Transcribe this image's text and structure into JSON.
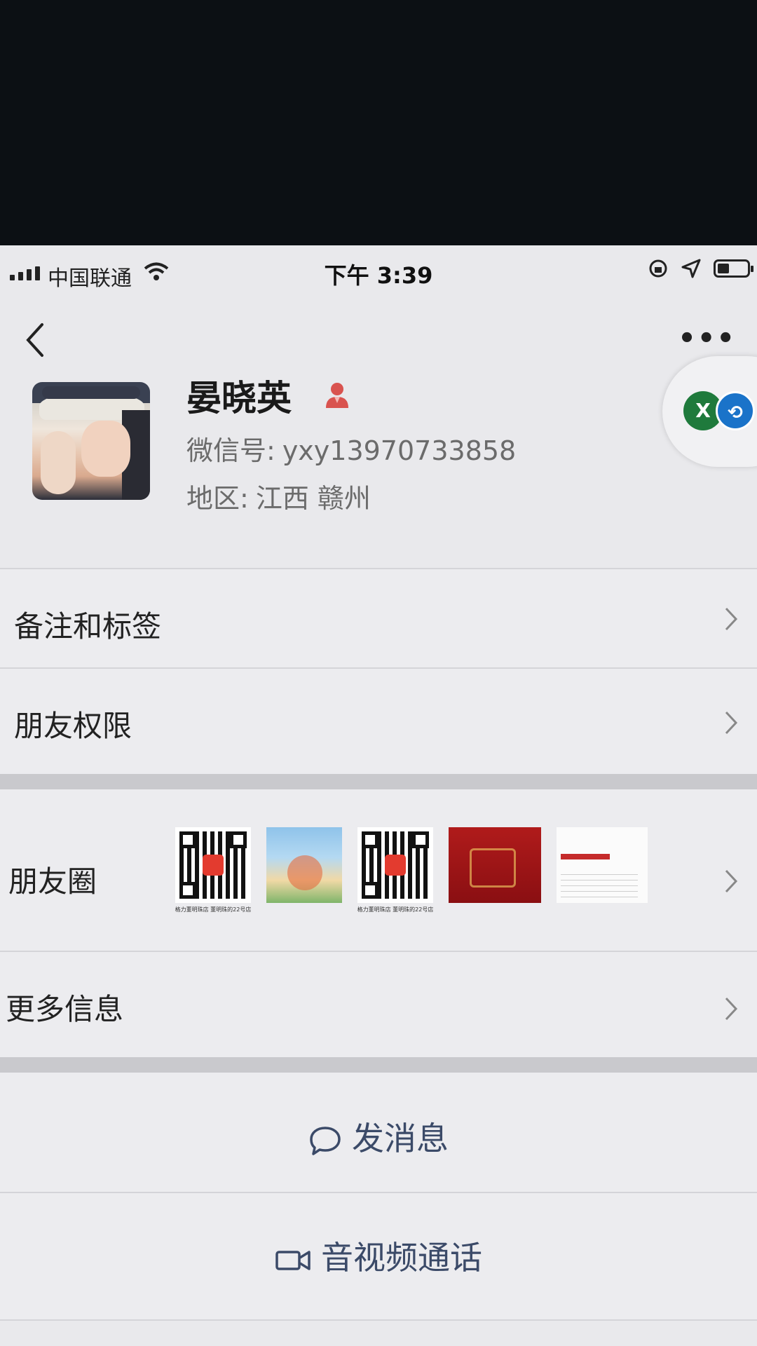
{
  "status_bar": {
    "carrier": "中国联通",
    "time": "下午 3:39"
  },
  "profile": {
    "name": "晏晓英",
    "wechat_id_label": "微信号:",
    "wechat_id": "yxy13970733858",
    "region_label": "地区:",
    "region": "江西 赣州"
  },
  "floating_button": {
    "letter": "X"
  },
  "rows": {
    "remarks_tags": "备注和标签",
    "friend_permissions": "朋友权限",
    "moments": "朋友圈",
    "more_info": "更多信息"
  },
  "moments_thumbs": {
    "qr_caption": "格力董明珠店 董明珠的22号店"
  },
  "actions": {
    "send_message": "发消息",
    "av_call": "音视频通话"
  },
  "colors": {
    "action_text": "#3b4a68",
    "gender_icon": "#d9534f"
  }
}
